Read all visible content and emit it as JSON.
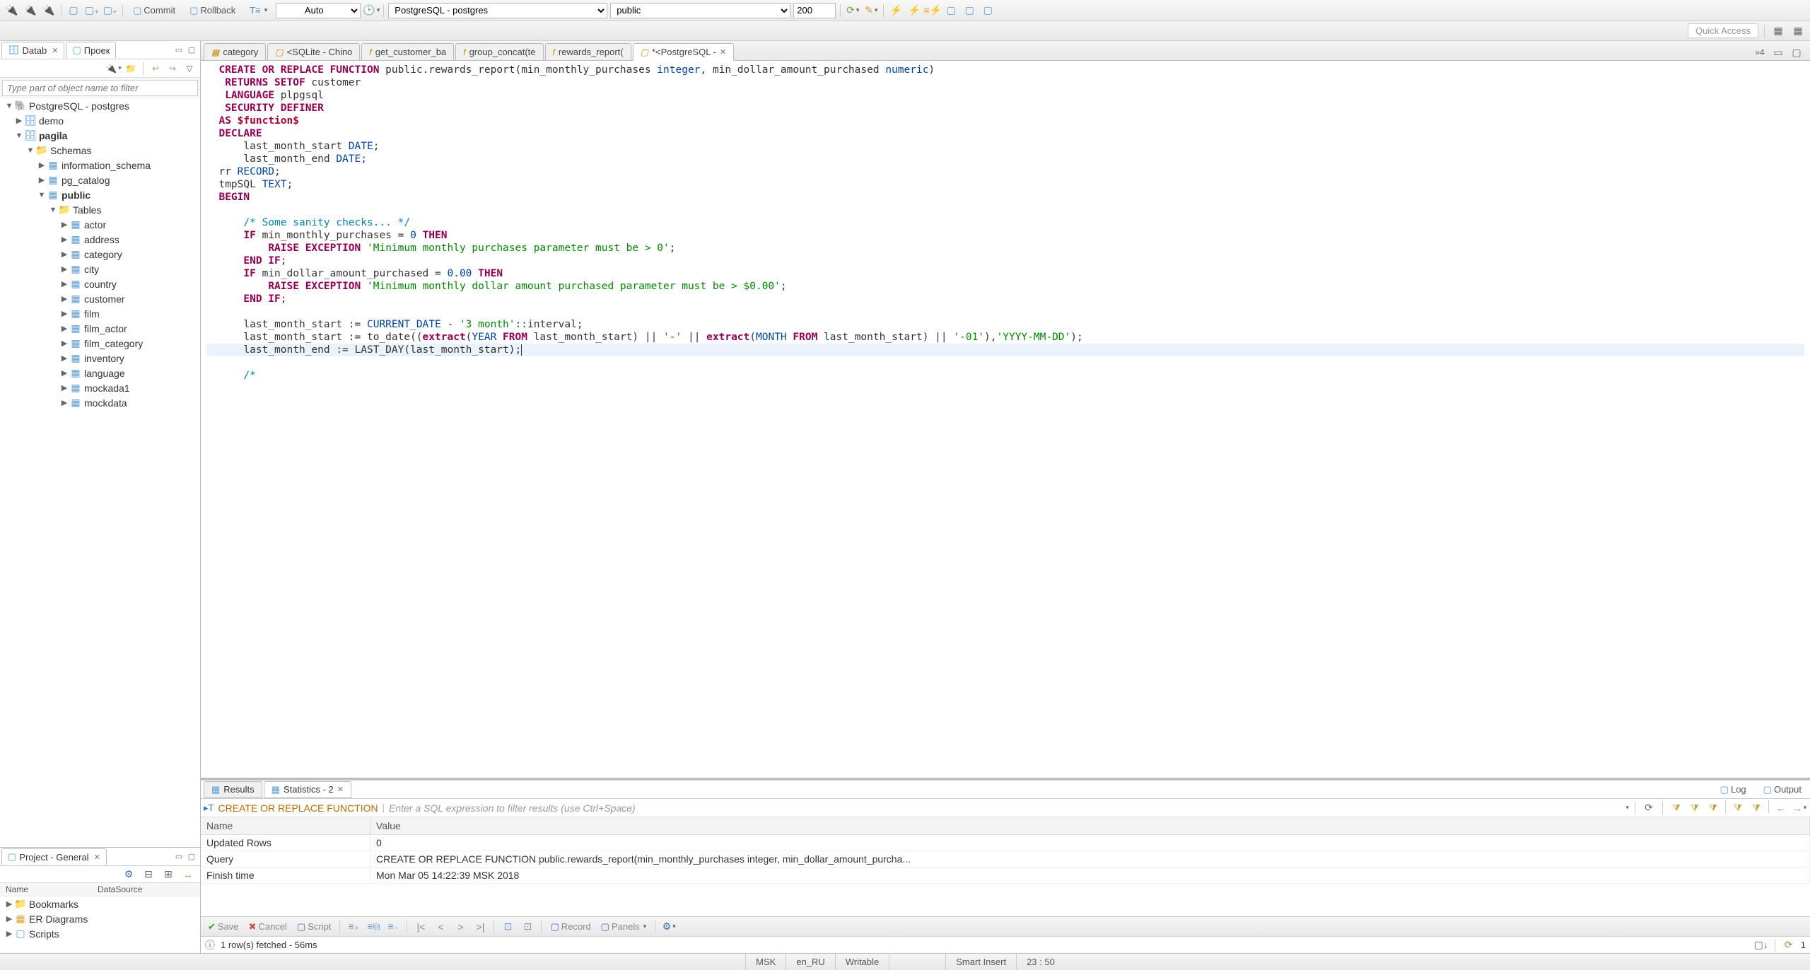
{
  "toolbar": {
    "commit_label": "Commit",
    "rollback_label": "Rollback",
    "auto_label": "Auto",
    "connection": "PostgreSQL - postgres",
    "schema": "public",
    "limit": "200"
  },
  "quick_access": "Quick Access",
  "left_panel": {
    "tabs": [
      {
        "label": "Datab"
      },
      {
        "label": "Проек"
      }
    ],
    "filter_placeholder": "Type part of object name to filter",
    "tree": [
      {
        "level": 0,
        "arrow": "▼",
        "icon": "pg",
        "label": "PostgreSQL - postgres",
        "bold": false
      },
      {
        "level": 1,
        "arrow": "▶",
        "icon": "db",
        "label": "demo",
        "bold": false
      },
      {
        "level": 1,
        "arrow": "▼",
        "icon": "db",
        "label": "pagila",
        "bold": true
      },
      {
        "level": 2,
        "arrow": "▼",
        "icon": "schemas",
        "label": "Schemas",
        "bold": false
      },
      {
        "level": 3,
        "arrow": "▶",
        "icon": "schema",
        "label": "information_schema",
        "bold": false
      },
      {
        "level": 3,
        "arrow": "▶",
        "icon": "schema",
        "label": "pg_catalog",
        "bold": false
      },
      {
        "level": 3,
        "arrow": "▼",
        "icon": "schema",
        "label": "public",
        "bold": true
      },
      {
        "level": 4,
        "arrow": "▼",
        "icon": "tables",
        "label": "Tables",
        "bold": false
      },
      {
        "level": 5,
        "arrow": "▶",
        "icon": "table",
        "label": "actor",
        "bold": false
      },
      {
        "level": 5,
        "arrow": "▶",
        "icon": "table",
        "label": "address",
        "bold": false
      },
      {
        "level": 5,
        "arrow": "▶",
        "icon": "table",
        "label": "category",
        "bold": false
      },
      {
        "level": 5,
        "arrow": "▶",
        "icon": "table",
        "label": "city",
        "bold": false
      },
      {
        "level": 5,
        "arrow": "▶",
        "icon": "table",
        "label": "country",
        "bold": false
      },
      {
        "level": 5,
        "arrow": "▶",
        "icon": "table",
        "label": "customer",
        "bold": false
      },
      {
        "level": 5,
        "arrow": "▶",
        "icon": "table",
        "label": "film",
        "bold": false
      },
      {
        "level": 5,
        "arrow": "▶",
        "icon": "table",
        "label": "film_actor",
        "bold": false
      },
      {
        "level": 5,
        "arrow": "▶",
        "icon": "table",
        "label": "film_category",
        "bold": false
      },
      {
        "level": 5,
        "arrow": "▶",
        "icon": "table",
        "label": "inventory",
        "bold": false
      },
      {
        "level": 5,
        "arrow": "▶",
        "icon": "table",
        "label": "language",
        "bold": false
      },
      {
        "level": 5,
        "arrow": "▶",
        "icon": "table",
        "label": "mockada1",
        "bold": false
      },
      {
        "level": 5,
        "arrow": "▶",
        "icon": "table",
        "label": "mockdata",
        "bold": false
      }
    ]
  },
  "project_panel": {
    "title": "Project - General",
    "cols": [
      "Name",
      "DataSource"
    ],
    "items": [
      {
        "label": "Bookmarks",
        "icon": "folder"
      },
      {
        "label": "ER Diagrams",
        "icon": "er"
      },
      {
        "label": "Scripts",
        "icon": "scripts"
      }
    ]
  },
  "editor_tabs": [
    {
      "icon": "table",
      "label": "category",
      "active": false
    },
    {
      "icon": "sql",
      "label": "<SQLite - Chino",
      "active": false
    },
    {
      "icon": "fn",
      "label": "get_customer_ba",
      "active": false
    },
    {
      "icon": "fn",
      "label": "group_concat(te",
      "active": false
    },
    {
      "icon": "fn",
      "label": "rewards_report(",
      "active": false
    },
    {
      "icon": "sqlactive",
      "label": "*<PostgreSQL - ",
      "active": true
    }
  ],
  "editor_overflow": "»4",
  "results": {
    "tabs": [
      {
        "label": "Results",
        "active": false
      },
      {
        "label": "Statistics - 2",
        "active": true
      }
    ],
    "log_label": "Log",
    "output_label": "Output",
    "sql_txt": "CREATE OR REPLACE FUNCTION",
    "filter_placeholder": "Enter a SQL expression to filter results (use Ctrl+Space)",
    "cols": [
      "Name",
      "Value"
    ],
    "rows": [
      {
        "name": "Updated Rows",
        "value": "0"
      },
      {
        "name": "Query",
        "value": "CREATE OR REPLACE FUNCTION public.rewards_report(min_monthly_purchases integer, min_dollar_amount_purcha..."
      },
      {
        "name": "Finish time",
        "value": "Mon Mar 05 14:22:39 MSK 2018"
      }
    ],
    "toolbar": {
      "save": "Save",
      "cancel": "Cancel",
      "script": "Script",
      "record": "Record",
      "panels": "Panels"
    },
    "status": "1 row(s) fetched - 56ms",
    "status_count": "1"
  },
  "status_bar": {
    "tz": "MSK",
    "locale": "en_RU",
    "mode": "Writable",
    "insert": "Smart Insert",
    "pos": "23 : 50"
  }
}
